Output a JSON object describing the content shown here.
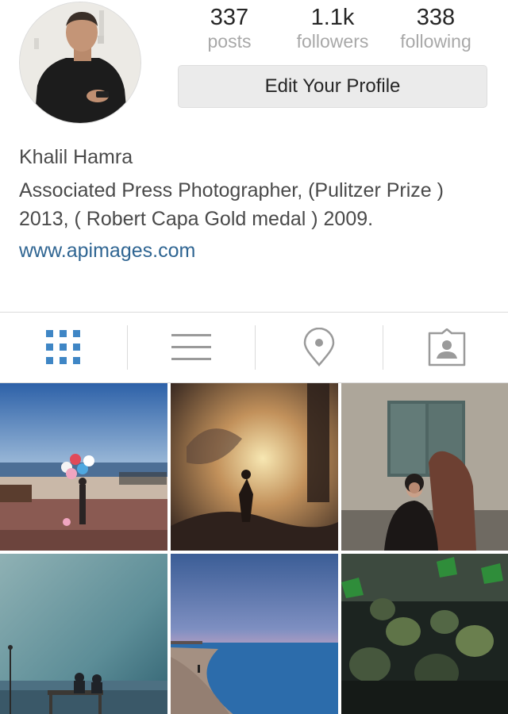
{
  "profile": {
    "username": "Khalil Hamra",
    "bio": "Associated Press Photographer, (Pulitzer Prize ) 2013, ( Robert Capa Gold medal ) 2009.",
    "website": "www.apimages.com"
  },
  "stats": {
    "posts": {
      "value": "337",
      "label": "posts"
    },
    "followers": {
      "value": "1.1k",
      "label": "followers"
    },
    "following": {
      "value": "338",
      "label": "following"
    }
  },
  "actions": {
    "edit_profile_label": "Edit Your Profile"
  },
  "tabs": [
    {
      "icon": "grid-icon",
      "active": true
    },
    {
      "icon": "list-icon",
      "active": false
    },
    {
      "icon": "location-pin-icon",
      "active": false
    },
    {
      "icon": "tagged-person-icon",
      "active": false
    }
  ],
  "colors": {
    "accent": "#3f86c5",
    "link": "#2f6592",
    "inactive_icon": "#9a9a9a",
    "button_bg": "#ebebeb"
  },
  "photos": [
    {
      "subject": "man with balloons on seaside promenade"
    },
    {
      "subject": "smoke and fire silhouettes"
    },
    {
      "subject": "couple embracing by old shuttered window"
    },
    {
      "subject": "people on bench at cloudy harbor"
    },
    {
      "subject": "beach at dusk"
    },
    {
      "subject": "crowd of masked fighters with green flags"
    }
  ]
}
